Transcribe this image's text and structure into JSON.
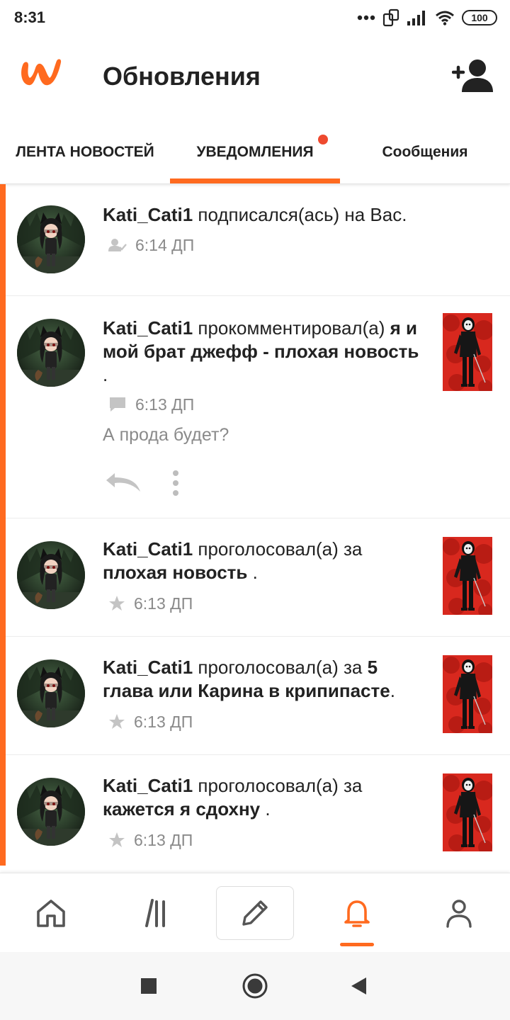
{
  "status_bar": {
    "time": "8:31",
    "battery": "100",
    "icons": [
      "more-dots-icon",
      "screen-rotate-icon",
      "signal-icon",
      "wifi-icon",
      "battery-icon"
    ]
  },
  "header": {
    "title": "Обновления",
    "logo": "wattpad-logo",
    "add_user_icon": "add-user-icon"
  },
  "tabs": [
    {
      "label": "ЛЕНТА НОВОСТЕЙ",
      "active": false
    },
    {
      "label": "УВЕДОМЛЕНИЯ",
      "active": true,
      "has_badge": true
    },
    {
      "label": "Сообщения",
      "active": false
    }
  ],
  "notifications": [
    {
      "user": "Kati_Cati1",
      "action": " подписался(ась) на Вас.",
      "story": "",
      "suffix": "",
      "time": "6:14 ДП",
      "icon": "follow-icon"
    },
    {
      "user": "Kati_Cati1",
      "action": " прокомментировал(а)",
      "story": "я и мой брат джефф - плохая новость",
      "suffix": " .",
      "time": "6:13 ДП",
      "icon": "comment-icon",
      "comment": "А прода будет?"
    },
    {
      "user": "Kati_Cati1",
      "action": " проголосовал(а) за",
      "story": "плохая новость",
      "suffix": " .",
      "time": "6:13 ДП",
      "icon": "star-icon"
    },
    {
      "user": "Kati_Cati1",
      "action": " проголосовал(а) за ",
      "story": "5 глава или Карина в крипипасте",
      "suffix": ".",
      "time": "6:13 ДП",
      "icon": "star-icon"
    },
    {
      "user": "Kati_Cati1",
      "action": " проголосовал(а) за",
      "story": "кажется я сдохну",
      "suffix": " .",
      "time": "6:13 ДП",
      "icon": "star-icon"
    }
  ],
  "bottom_nav": [
    {
      "name": "home-icon"
    },
    {
      "name": "library-icon"
    },
    {
      "name": "write-icon"
    },
    {
      "name": "notifications-bell-icon",
      "active": true
    },
    {
      "name": "profile-icon"
    }
  ],
  "colors": {
    "accent": "#ff6a1f",
    "badge": "#ee4a2f",
    "muted_text": "#8a8a8a"
  }
}
